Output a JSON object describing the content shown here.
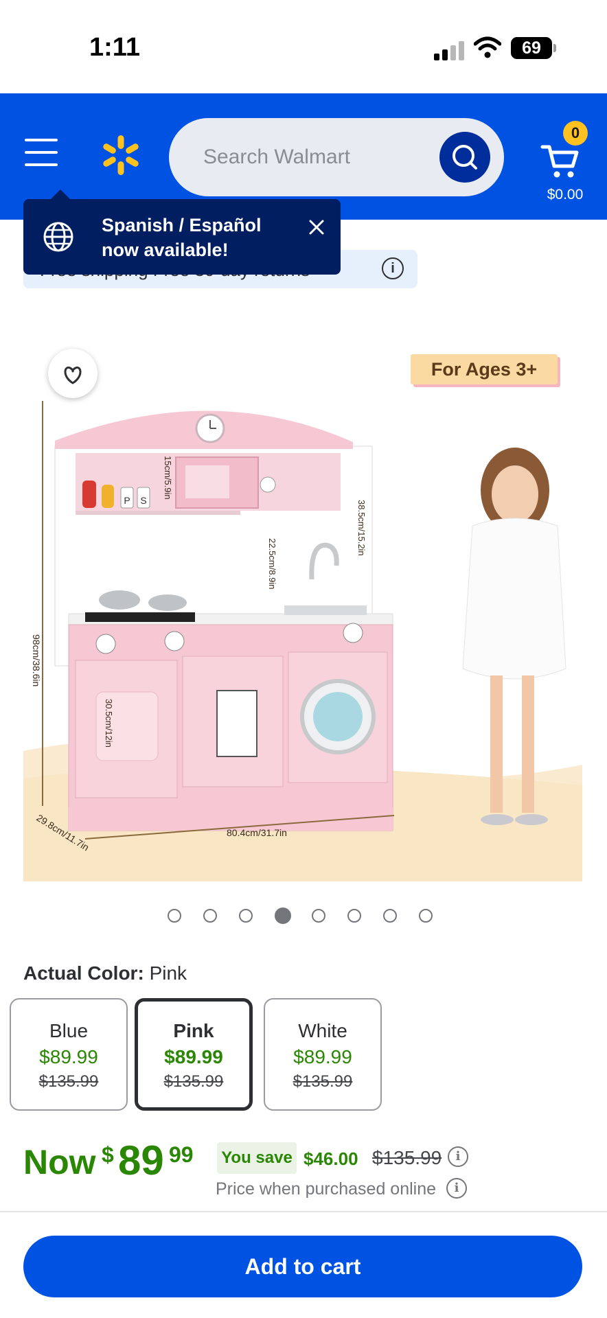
{
  "status_bar": {
    "time": "1:11",
    "battery": "69"
  },
  "header": {
    "search_placeholder": "Search Walmart",
    "cart_count": "0",
    "cart_total": "$0.00"
  },
  "info_chip": {
    "text": "Free shipping  Free 30-day returns"
  },
  "tooltip": {
    "line1": "Spanish / Español",
    "line2": "now available!"
  },
  "product_image": {
    "age_badge": "For Ages 3+",
    "dims": {
      "height": "98cm/38.6in",
      "depth": "29.8cm/11.7in",
      "width": "80.4cm/31.7in",
      "shelf": "15cm/5.9in",
      "top": "38.5cm/15.2in",
      "mid": "22.5cm/8.9in",
      "door": "30.5cm/12in"
    },
    "shaker_p": "P",
    "shaker_s": "S"
  },
  "carousel": {
    "count": 8,
    "active_index": 3
  },
  "color": {
    "label": "Actual Color:",
    "value": "Pink",
    "variants": [
      {
        "name": "Blue",
        "price": "$89.99",
        "was": "$135.99"
      },
      {
        "name": "Pink",
        "price": "$89.99",
        "was": "$135.99"
      },
      {
        "name": "White",
        "price": "$89.99",
        "was": "$135.99"
      }
    ]
  },
  "price": {
    "now_label": "Now",
    "currency": "$",
    "dollars": "89",
    "cents": "99",
    "you_save_label": "You save",
    "save_amount": "$46.00",
    "was": "$135.99",
    "online_note": "Price when purchased online"
  },
  "cta": {
    "add_to_cart": "Add to cart"
  },
  "colors": {
    "brand_blue": "#0053e2",
    "spark_yellow": "#ffc220",
    "price_green": "#2a8703",
    "tooltip_navy": "#001e60"
  }
}
